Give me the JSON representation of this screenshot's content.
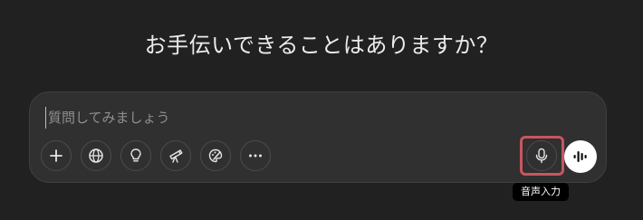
{
  "heading": "お手伝いできることはありますか？",
  "composer": {
    "placeholder": "質問してみましょう",
    "value": ""
  },
  "tools": [
    {
      "name": "add-button",
      "icon": "plus-icon"
    },
    {
      "name": "web-search-button",
      "icon": "globe-icon"
    },
    {
      "name": "think-button",
      "icon": "lightbulb-icon"
    },
    {
      "name": "deep-research-button",
      "icon": "telescope-icon"
    },
    {
      "name": "image-create-button",
      "icon": "palette-icon"
    },
    {
      "name": "more-tools-button",
      "icon": "ellipsis-icon"
    }
  ],
  "mic": {
    "icon": "microphone-icon",
    "tooltip": "音声入力"
  },
  "voice_mode": {
    "icon": "waveform-icon"
  },
  "colors": {
    "background": "#212121",
    "composer": "#303030",
    "highlight": "#c8555e"
  }
}
